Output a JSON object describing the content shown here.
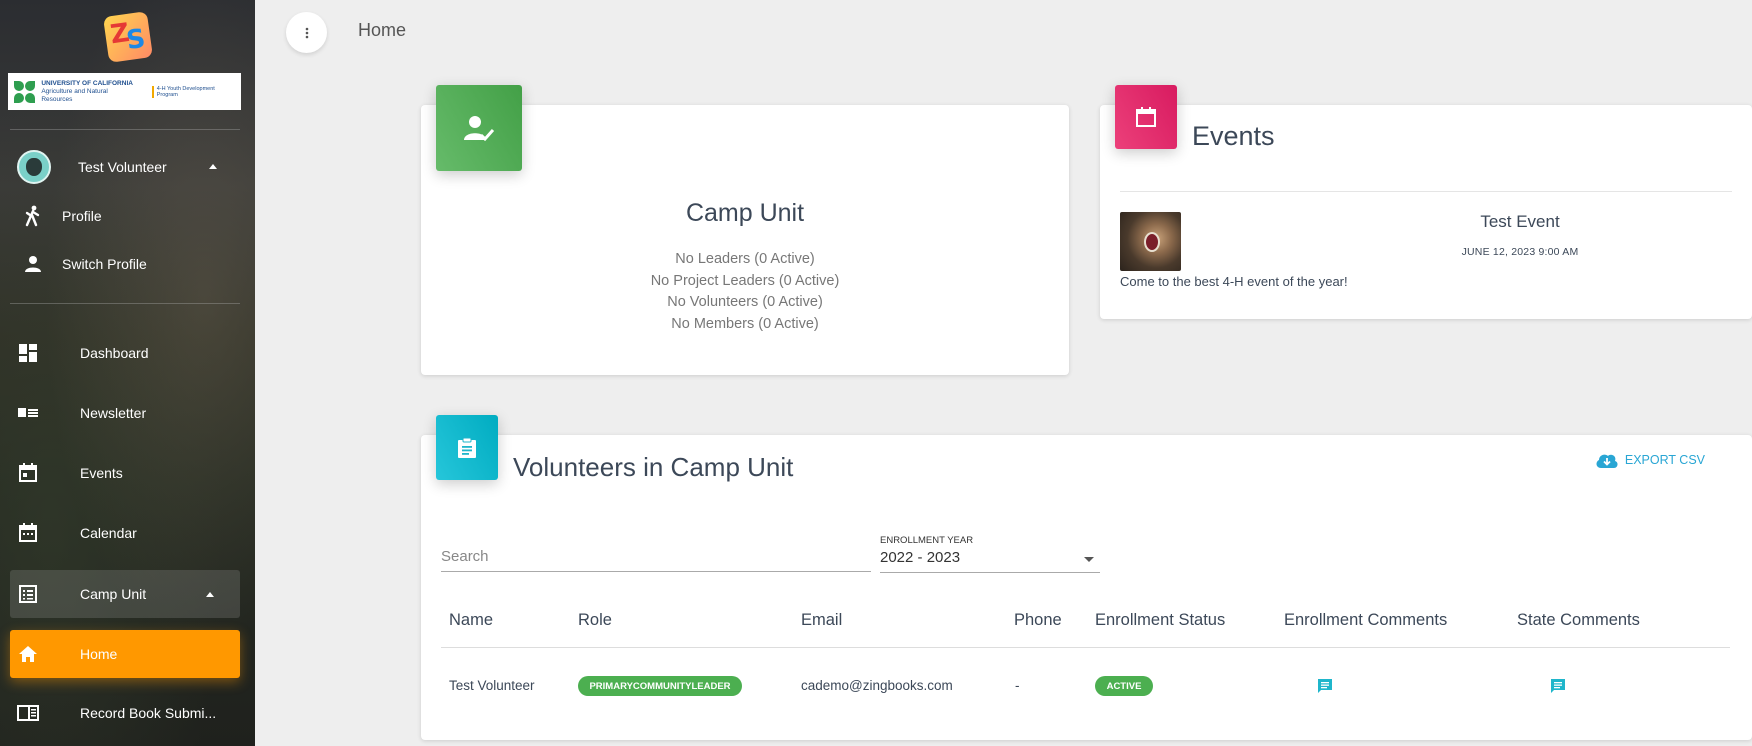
{
  "app": {
    "logo_text": "ZS",
    "org_banner": {
      "line1": "UNIVERSITY OF CALIFORNIA",
      "line2": "Agriculture and Natural Resources",
      "program": "4-H Youth Development Program"
    }
  },
  "sidebar": {
    "user": {
      "name": "Test Volunteer"
    },
    "user_menu": [
      {
        "label": "Profile",
        "icon": "person-walking-icon"
      },
      {
        "label": "Switch Profile",
        "icon": "person-icon"
      }
    ],
    "nav": [
      {
        "label": "Dashboard",
        "icon": "dashboard-icon"
      },
      {
        "label": "Newsletter",
        "icon": "newsletter-icon"
      },
      {
        "label": "Events",
        "icon": "calendar-event-icon"
      },
      {
        "label": "Calendar",
        "icon": "calendar-icon"
      },
      {
        "label": "Camp Unit",
        "icon": "list-icon",
        "expanded": true
      },
      {
        "label": "Home",
        "icon": "home-icon",
        "active": true
      },
      {
        "label": "Record Book Submi...",
        "icon": "record-book-icon"
      }
    ]
  },
  "topbar": {
    "title": "Home"
  },
  "camp_card": {
    "title": "Camp Unit",
    "stats": [
      "No Leaders (0 Active)",
      "No Project Leaders (0 Active)",
      "No Volunteers (0 Active)",
      "No Members (0 Active)"
    ]
  },
  "events_card": {
    "title": "Events",
    "event": {
      "title": "Test Event",
      "date": "JUNE 12, 2023 9:00 AM",
      "description": "Come to the best 4-H event of the year!"
    }
  },
  "volunteers_card": {
    "title": "Volunteers in Camp Unit",
    "export_label": "EXPORT CSV",
    "search_placeholder": "Search",
    "year_label": "ENROLLMENT YEAR",
    "year_value": "2022 - 2023",
    "columns": [
      "Name",
      "Role",
      "Email",
      "Phone",
      "Enrollment Status",
      "Enrollment Comments",
      "State Comments"
    ],
    "rows": [
      {
        "name": "Test Volunteer",
        "role": "PRIMARYCOMMUNITYLEADER",
        "email": "cademo@zingbooks.com",
        "phone": "-",
        "status": "ACTIVE"
      }
    ]
  },
  "colors": {
    "accent_orange": "#ff9800",
    "green": "#4caf50",
    "pink": "#e91e63",
    "cyan": "#00bcd4",
    "link_blue": "#29a6d4"
  }
}
